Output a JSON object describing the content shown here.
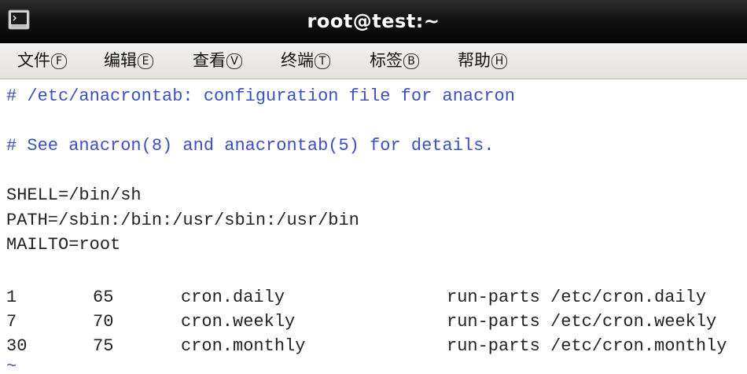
{
  "window": {
    "title": "root@test:~",
    "icon": "terminal-icon"
  },
  "menu": [
    {
      "label": "文件",
      "mnemonic": "F"
    },
    {
      "label": "编辑",
      "mnemonic": "E"
    },
    {
      "label": "查看",
      "mnemonic": "V"
    },
    {
      "label": "终端",
      "mnemonic": "T"
    },
    {
      "label": "标签",
      "mnemonic": "B"
    },
    {
      "label": "帮助",
      "mnemonic": "H"
    }
  ],
  "terminal": {
    "comment1": "# /etc/anacrontab: configuration file for anacron",
    "comment2": "# See anacron(8) and anacrontab(5) for details.",
    "env": [
      "SHELL=/bin/sh",
      "PATH=/sbin:/bin:/usr/sbin:/usr/bin",
      "MAILTO=root"
    ],
    "jobs": [
      {
        "period": "1",
        "delay": "65",
        "id": "cron.daily",
        "command": "run-parts /etc/cron.daily"
      },
      {
        "period": "7",
        "delay": "70",
        "id": "cron.weekly",
        "command": "run-parts /etc/cron.weekly"
      },
      {
        "period": "30",
        "delay": "75",
        "id": "cron.monthly",
        "command": "run-parts /etc/cron.monthly"
      }
    ],
    "tilde": "~"
  },
  "colors": {
    "comment": "#3a4fc4",
    "text": "#222222",
    "titlebar": "#131313"
  }
}
